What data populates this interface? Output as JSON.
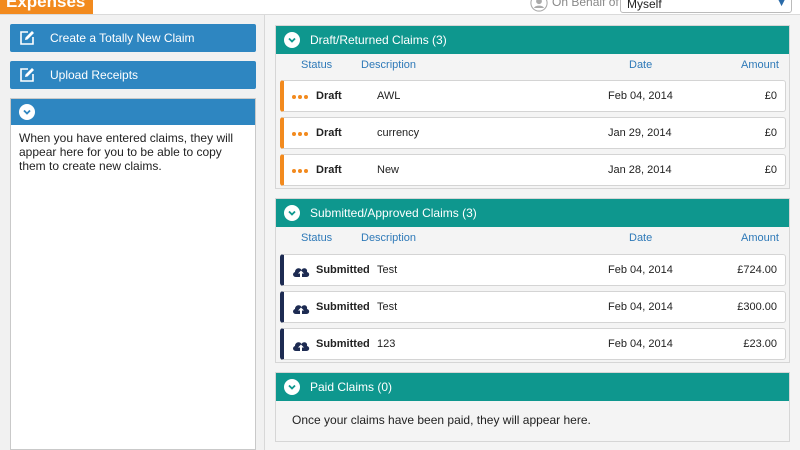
{
  "header": {
    "app_tab": "Expenses",
    "on_behalf_label": "On Behalf of",
    "on_behalf_value": "Myself"
  },
  "sidebar": {
    "create_claim": "Create a Totally New Claim",
    "upload_receipts": "Upload Receipts",
    "info_text": "When you have entered claims, they will appear here for you to be able to copy them to create new claims."
  },
  "columns": {
    "status": "Status",
    "description": "Description",
    "date": "Date",
    "amount": "Amount"
  },
  "draft": {
    "title": "Draft/Returned Claims (3)",
    "rows": [
      {
        "status": "Draft",
        "description": "AWL",
        "date": "Feb 04, 2014",
        "amount": "£0"
      },
      {
        "status": "Draft",
        "description": "currency",
        "date": "Jan 29, 2014",
        "amount": "£0"
      },
      {
        "status": "Draft",
        "description": "New",
        "date": "Jan 28, 2014",
        "amount": "£0"
      }
    ]
  },
  "submitted": {
    "title": "Submitted/Approved Claims (3)",
    "rows": [
      {
        "status": "Submitted",
        "description": "Test",
        "date": "Feb 04, 2014",
        "amount": "£724.00"
      },
      {
        "status": "Submitted",
        "description": "Test",
        "date": "Feb 04, 2014",
        "amount": "£300.00"
      },
      {
        "status": "Submitted",
        "description": "123",
        "date": "Feb 04, 2014",
        "amount": "£23.00"
      }
    ]
  },
  "paid": {
    "title": "Paid Claims (0)",
    "message": "Once your claims have been paid, they will appear here."
  },
  "colors": {
    "accent_blue": "#2e86c1",
    "section_teal": "#0e978e",
    "draft_orange": "#f28a1e",
    "submitted_navy": "#1d2b52"
  },
  "icons": {
    "edit": "edit-icon",
    "collapse": "chevron-down-icon",
    "draft_status": "dots-icon",
    "submitted_status": "cloud-upload-icon",
    "user": "user-icon"
  }
}
